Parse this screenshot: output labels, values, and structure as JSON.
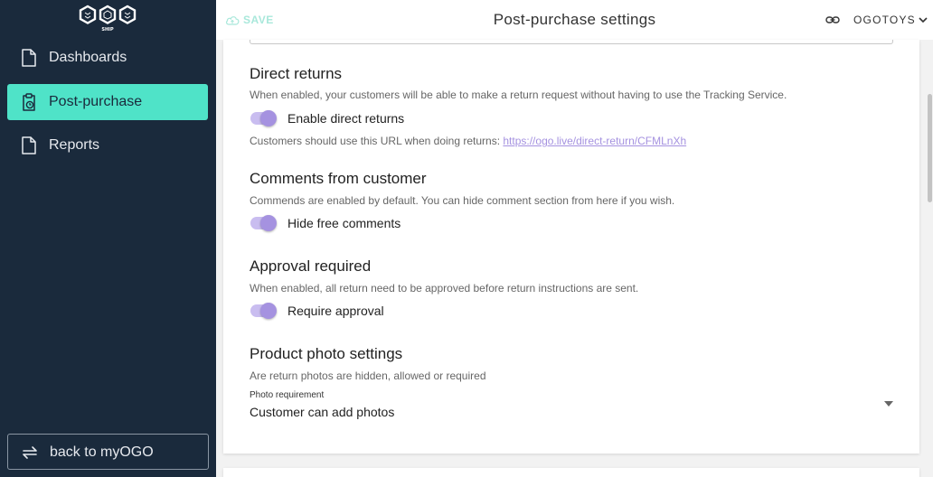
{
  "sidebar": {
    "logo_text": "OGO SHIP",
    "items": [
      {
        "label": "Dashboards",
        "icon": "document-icon",
        "active": false
      },
      {
        "label": "Post-purchase",
        "icon": "clipboard-clock-icon",
        "active": true
      },
      {
        "label": "Reports",
        "icon": "document-icon",
        "active": false
      }
    ],
    "back_label": "back to myOGO"
  },
  "header": {
    "save_label": "SAVE",
    "title": "Post-purchase settings",
    "account_label": "OGOTOYS"
  },
  "sections": {
    "direct_returns": {
      "title": "Direct returns",
      "description": "When enabled, your customers will be able to make a return request without having to use the Tracking Service.",
      "toggle_label": "Enable direct returns",
      "toggle_on": true,
      "url_prefix": "Customers should use this URL when doing returns:",
      "url": "https://ogo.live/direct-return/CFMLnXh"
    },
    "comments": {
      "title": "Comments from customer",
      "description": "Commends are enabled by default. You can hide comment section from here if you wish.",
      "toggle_label": "Hide free comments",
      "toggle_on": true
    },
    "approval": {
      "title": "Approval required",
      "description": "When enabled, all return need to be approved before return instructions are sent.",
      "toggle_label": "Require approval",
      "toggle_on": true
    },
    "photos": {
      "title": "Product photo settings",
      "description": "Are return photos are hidden, allowed or required",
      "select_label": "Photo requirement",
      "select_value": "Customer can add photos"
    }
  },
  "colors": {
    "sidebar_bg": "#1a2a3c",
    "active_accent": "#4fe3c8",
    "toggle_purple": "#a592e0"
  }
}
